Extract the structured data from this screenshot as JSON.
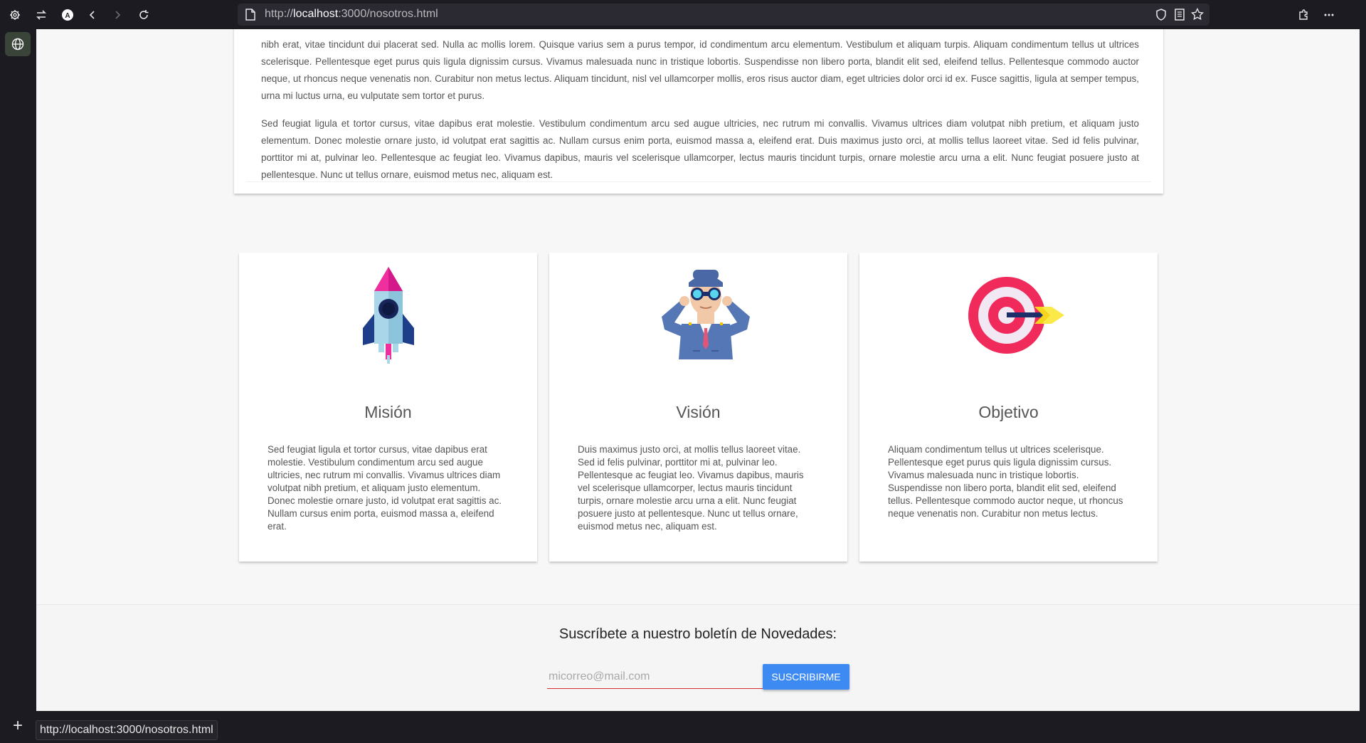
{
  "browser": {
    "url_prefix": "http://",
    "url_host": "localhost",
    "url_rest": ":3000/nosotros.html",
    "status_url": "http://localhost:3000/nosotros.html"
  },
  "intro": {
    "paragraph1_cut": "nibh erat, vitae tincidunt dui placerat sed. Nulla ac mollis lorem. Quisque varius sem a purus tempor, id condimentum arcu elementum. Vestibulum et aliquam turpis. Aliquam condimentum tellus ut ultrices scelerisque. Pellentesque eget purus quis ligula dignissim cursus. Vivamus malesuada nunc in tristique lobortis. Suspendisse non libero porta, blandit elit sed, eleifend tellus. Pellentesque commodo auctor neque, ut rhoncus neque venenatis non. Curabitur non metus lectus. Aliquam tincidunt, nisl vel ullamcorper mollis, eros risus auctor diam, eget ultricies dolor orci id ex. Fusce sagittis, ligula at semper tempus, urna mi luctus urna, eu vulputate sem tortor et purus.",
    "paragraph2": "Sed feugiat ligula et tortor cursus, vitae dapibus erat molestie. Vestibulum condimentum arcu sed augue ultricies, nec rutrum mi convallis. Vivamus ultrices diam volutpat nibh pretium, et aliquam justo elementum. Donec molestie ornare justo, id volutpat erat sagittis ac. Nullam cursus enim porta, euismod massa a, eleifend erat. Duis maximus justo orci, at mollis tellus laoreet vitae. Sed id felis pulvinar, porttitor mi at, pulvinar leo. Pellentesque ac feugiat leo. Vivamus dapibus, mauris vel scelerisque ullamcorper, lectus mauris tincidunt turpis, ornare molestie arcu urna a elit. Nunc feugiat posuere justo at pellentesque. Nunc ut tellus ornare, euismod metus nec, aliquam est."
  },
  "cards": [
    {
      "icon": "rocket-icon",
      "title": "Misión",
      "text": "Sed feugiat ligula et tortor cursus, vitae dapibus erat molestie. Vestibulum condimentum arcu sed augue ultricies, nec rutrum mi convallis. Vivamus ultrices diam volutpat nibh pretium, et aliquam justo elementum. Donec molestie ornare justo, id volutpat erat sagittis ac. Nullam cursus enim porta, euismod massa a, eleifend erat."
    },
    {
      "icon": "binoculars-man-icon",
      "title": "Visión",
      "text": "Duis maximus justo orci, at mollis tellus laoreet vitae. Sed id felis pulvinar, porttitor mi at, pulvinar leo. Pellentesque ac feugiat leo. Vivamus dapibus, mauris vel scelerisque ullamcorper, lectus mauris tincidunt turpis, ornare molestie arcu urna a elit. Nunc feugiat posuere justo at pellentesque. Nunc ut tellus ornare, euismod metus nec, aliquam est."
    },
    {
      "icon": "target-icon",
      "title": "Objetivo",
      "text": "Aliquam condimentum tellus ut ultrices scelerisque. Pellentesque eget purus quis ligula dignissim cursus. Vivamus malesuada nunc in tristique lobortis. Suspendisse non libero porta, blandit elit sed, eleifend tellus. Pellentesque commodo auctor neque, ut rhoncus neque venenatis non. Curabitur non metus lectus."
    }
  ],
  "newsletter": {
    "title": "Suscríbete a nuestro boletín de Novedades:",
    "placeholder": "micorreo@mail.com",
    "button": "SUSCRIBIRME"
  },
  "colors": {
    "accent_button": "#3d8bf2",
    "input_underline": "#d32f2f"
  }
}
